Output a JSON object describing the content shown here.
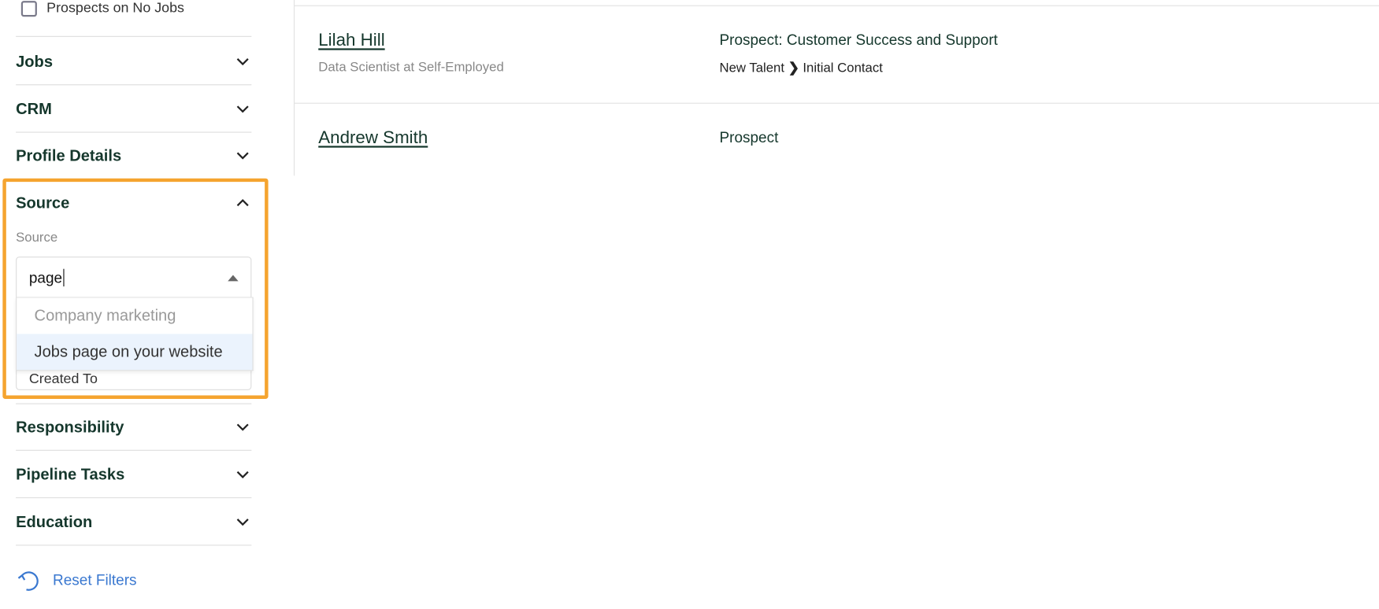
{
  "sidebar": {
    "prospects_no_jobs": {
      "label": "Prospects on No Jobs",
      "checked": false
    },
    "sections": [
      {
        "label": "Jobs",
        "expanded": false
      },
      {
        "label": "CRM",
        "expanded": false
      },
      {
        "label": "Profile Details",
        "expanded": false
      },
      {
        "label": "Source",
        "expanded": true
      },
      {
        "label": "Responsibility",
        "expanded": false
      },
      {
        "label": "Pipeline Tasks",
        "expanded": false
      },
      {
        "label": "Education",
        "expanded": false
      }
    ],
    "source_filter": {
      "field_label": "Source",
      "input_value": "page",
      "options": [
        "Company marketing",
        "Jobs page on your website"
      ],
      "highlighted_option": "Jobs page on your website",
      "hidden_field_label": "Created To"
    },
    "reset_label": "Reset Filters",
    "highlight_color": "#f5a42f",
    "link_color": "#3a78d0"
  },
  "results": [
    {
      "name": "Lilah Hill",
      "subtitle": "Data Scientist at Self-Employed",
      "status": "Prospect: Customer Success and Support",
      "pipeline_from": "New Talent",
      "pipeline_to": "Initial Contact"
    },
    {
      "name": "Andrew Smith",
      "status": "Prospect"
    }
  ]
}
